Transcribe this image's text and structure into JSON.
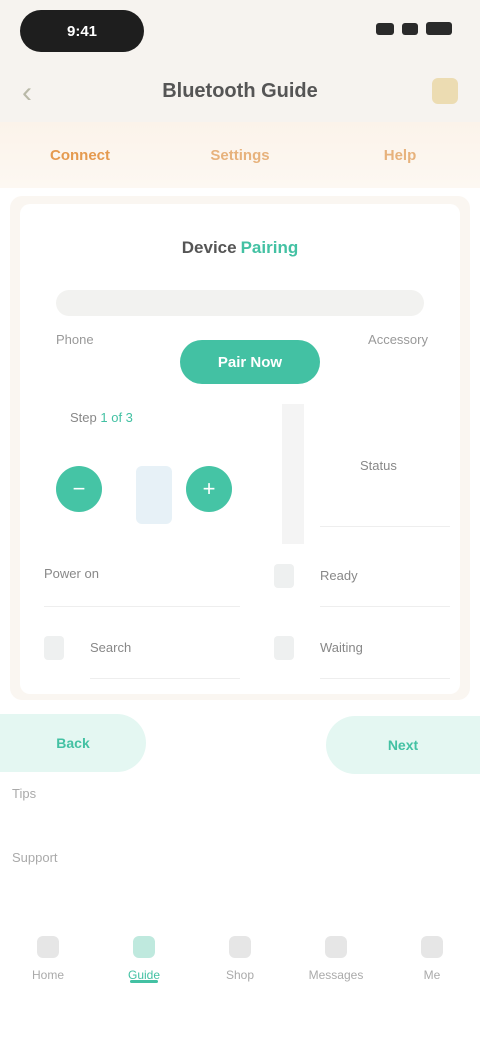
{
  "status_bar": {
    "time": "9:41"
  },
  "nav": {
    "title": "Bluetooth Guide",
    "back_icon": "chevron-left-icon",
    "right_icon": "share-icon"
  },
  "tabs": [
    {
      "label": "Connect",
      "active": true
    },
    {
      "label": "Settings",
      "active": false
    },
    {
      "label": "Help",
      "active": false
    }
  ],
  "card": {
    "title": "Device",
    "title_highlight": "Pairing",
    "left_label": "Phone",
    "right_label": "Accessory",
    "main_button": "Pair Now",
    "section_left": "Step",
    "section_left_highlight": "1 of 3",
    "section_right": "Status",
    "row_left_1": "Power on",
    "row_left_2": "Search",
    "row_right_1": "Ready",
    "row_right_2": "Waiting"
  },
  "actions": {
    "left": "Back",
    "right": "Next"
  },
  "footer": {
    "line1": "Tips",
    "line2": "Support"
  },
  "bottom_nav": [
    {
      "label": "Home",
      "active": false
    },
    {
      "label": "Guide",
      "active": true
    },
    {
      "label": "Shop",
      "active": false
    },
    {
      "label": "Messages",
      "active": false
    },
    {
      "label": "Me",
      "active": false
    }
  ],
  "colors": {
    "accent": "#43c1a3",
    "tab": "#e59a4f",
    "background": "#f6f3ef"
  }
}
